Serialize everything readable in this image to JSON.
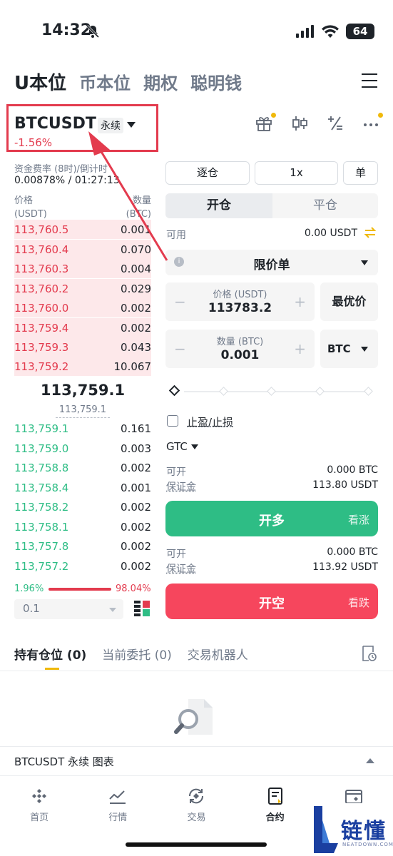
{
  "status": {
    "time": "14:32",
    "battery": "64"
  },
  "top_tabs": [
    "U本位",
    "币本位",
    "期权",
    "聪明钱"
  ],
  "symbol": {
    "name": "BTCUSDT",
    "badge": "永续",
    "change": "-1.56%"
  },
  "funding": {
    "label": "资金费率 (8时)/倒计时",
    "value": "0.00878% / 01:27:13"
  },
  "orderbook": {
    "price_header": "价格",
    "price_unit": "(USDT)",
    "qty_header": "数量",
    "qty_unit": "(BTC)",
    "asks": [
      {
        "price": "113,760.5",
        "qty": "0.001"
      },
      {
        "price": "113,760.4",
        "qty": "0.070"
      },
      {
        "price": "113,760.3",
        "qty": "0.004"
      },
      {
        "price": "113,760.2",
        "qty": "0.029"
      },
      {
        "price": "113,760.0",
        "qty": "0.002"
      },
      {
        "price": "113,759.4",
        "qty": "0.002"
      },
      {
        "price": "113,759.3",
        "qty": "0.043"
      },
      {
        "price": "113,759.2",
        "qty": "10.067"
      }
    ],
    "last_price": "113,759.1",
    "mark_price": "113,759.1",
    "bids": [
      {
        "price": "113,759.1",
        "qty": "0.161"
      },
      {
        "price": "113,759.0",
        "qty": "0.003"
      },
      {
        "price": "113,758.8",
        "qty": "0.002"
      },
      {
        "price": "113,758.4",
        "qty": "0.001"
      },
      {
        "price": "113,758.2",
        "qty": "0.002"
      },
      {
        "price": "113,758.1",
        "qty": "0.002"
      },
      {
        "price": "113,757.8",
        "qty": "0.002"
      },
      {
        "price": "113,757.2",
        "qty": "0.002"
      }
    ],
    "buy_ratio": "1.96%",
    "sell_ratio": "98.04%",
    "depth": "0.1"
  },
  "order_form": {
    "margin_mode": "逐仓",
    "leverage": "1x",
    "position_mode": "单",
    "open_tab": "开仓",
    "close_tab": "平仓",
    "available_label": "可用",
    "available_value": "0.00 USDT",
    "order_type": "限价单",
    "price_label": "价格 (USDT)",
    "price_value": "113783.2",
    "best_price": "最优价",
    "qty_label": "数量 (BTC)",
    "qty_value": "0.001",
    "qty_unit": "BTC",
    "tpsl": "止盈/止损",
    "tif": "GTC",
    "long": {
      "open_label": "可开",
      "open_value": "0.000 BTC",
      "margin_label": "保证金",
      "margin_value": "113.80 USDT",
      "button": "开多",
      "hint": "看涨"
    },
    "short": {
      "open_label": "可开",
      "open_value": "0.000 BTC",
      "margin_label": "保证金",
      "margin_value": "113.92 USDT",
      "button": "开空",
      "hint": "看跌"
    }
  },
  "positions": {
    "tabs": [
      "持有仓位 (0)",
      "当前委托 (0)",
      "交易机器人"
    ]
  },
  "chart_bar": {
    "title": "BTCUSDT 永续  图表"
  },
  "nav": [
    "首页",
    "行情",
    "交易",
    "合约",
    "资产"
  ],
  "watermark": {
    "text": "链懂",
    "sub": "NEATDOWN.COM"
  },
  "colors": {
    "red": "#e33b4e",
    "green": "#2ebd85",
    "yellow": "#f0b90b"
  }
}
